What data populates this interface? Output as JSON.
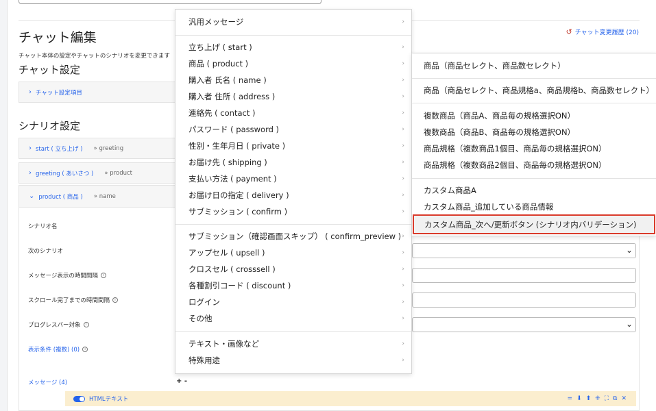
{
  "chat": {
    "edit_title": "チャット編集",
    "history_link": "チャット変更履歴 (20)",
    "description": "チャット本体の設定やチャットのシナリオを変更できます",
    "settings_title": "チャット設定",
    "settings_item": "チャット設定項目"
  },
  "scenario": {
    "title": "シナリオ設定",
    "rows": [
      {
        "chev": "›",
        "label": "start ( 立ち上げ )",
        "next": "» greeting"
      },
      {
        "chev": "›",
        "label": "greeting ( あいさつ )",
        "next": "» product"
      },
      {
        "chev": "⌄",
        "label": "product ( 商品 )",
        "next": "» name"
      }
    ],
    "fields": {
      "name_label": "シナリオ名",
      "next_label": "次のシナリオ",
      "msg_interval_label": "メッセージ表示の時間間隔",
      "scroll_interval_label": "スクロール完了までの時間間隔",
      "progress_label": "プログレスバー対象",
      "display_cond_label": "表示条件 (複数) (0)",
      "messages_label": "メッセージ (4)"
    },
    "plusminus": "+ -",
    "html_block_label": "HTMLテキスト",
    "tools": [
      "=",
      "⬇",
      "⬆",
      "⁜",
      "⛶",
      "⧉",
      "✕"
    ]
  },
  "menu_main": {
    "items": [
      {
        "label": "汎用メッセージ",
        "arrow": "›"
      },
      {
        "label": "立ち上げ ( start )",
        "arrow": "›"
      },
      {
        "label": "商品 ( product )",
        "arrow": "›"
      },
      {
        "label": "購入者 氏名 ( name )",
        "arrow": "›"
      },
      {
        "label": "購入者 住所 ( address )",
        "arrow": "›"
      },
      {
        "label": "連絡先 ( contact )",
        "arrow": "›"
      },
      {
        "label": "パスワード ( password )",
        "arrow": "›"
      },
      {
        "label": "性別・生年月日 ( private )",
        "arrow": "›"
      },
      {
        "label": "お届け先 ( shipping )",
        "arrow": "›"
      },
      {
        "label": "支払い方法 ( payment )",
        "arrow": "›"
      },
      {
        "label": "お届け日の指定 ( delivery )",
        "arrow": "›"
      },
      {
        "label": "サブミッション ( confirm )",
        "arrow": "›"
      },
      {
        "label": "サブミッション（確認画面スキップ） ( confirm_preview )",
        "arrow": "›"
      },
      {
        "label": "アップセル ( upsell )",
        "arrow": "›"
      },
      {
        "label": "クロスセル ( crosssell )",
        "arrow": "›"
      },
      {
        "label": "各種割引コード ( discount )",
        "arrow": "›"
      },
      {
        "label": "ログイン",
        "arrow": "›"
      },
      {
        "label": "その他",
        "arrow": "›"
      },
      {
        "label": "テキスト・画像など",
        "arrow": "›"
      },
      {
        "label": "特殊用途",
        "arrow": "›"
      }
    ]
  },
  "menu_sub": {
    "items": [
      {
        "label": "商品（商品セレクト、商品数セレクト）"
      },
      {
        "label": "商品（商品セレクト、商品規格a、商品規格b、商品数セレクト）"
      },
      {
        "label": "複数商品（商品A、商品毎の規格選択ON）"
      },
      {
        "label": "複数商品（商品B、商品毎の規格選択ON）"
      },
      {
        "label": "商品規格（複数商品1個目、商品毎の規格選択ON）"
      },
      {
        "label": "商品規格（複数商品2個目、商品毎の規格選択ON）"
      },
      {
        "label": "カスタム商品A"
      },
      {
        "label": "カスタム商品_追加している商品情報"
      },
      {
        "label": "カスタム商品_次へ/更新ボタン (シナリオ内バリデーション)"
      }
    ]
  },
  "colors": {
    "accent": "#2563eb",
    "highlight": "#d93a2b",
    "block_bg": "#fbeecf"
  }
}
